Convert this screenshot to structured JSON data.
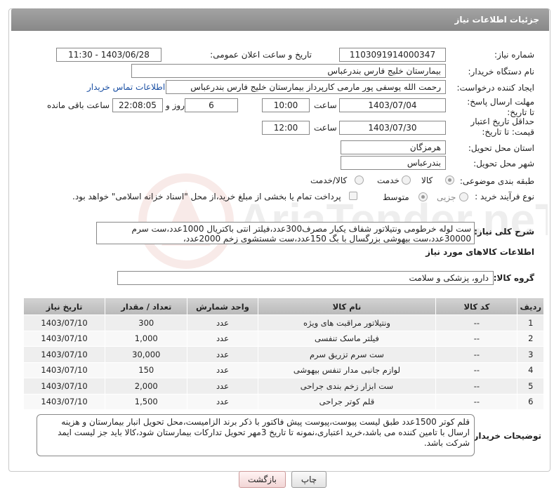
{
  "header": {
    "title": "جزئیات اطلاعات نیاز"
  },
  "form": {
    "need_number_label": "شماره نیاز:",
    "need_number": "1103091914000347",
    "announce_label": "تاریخ و ساعت اعلان عمومی:",
    "announce_value": "1403/06/28 - 11:30",
    "buyer_org_label": "نام دستگاه خریدار:",
    "buyer_org": "بیمارستان خلیج فارس بندرعباس",
    "creator_label": "ایجاد کننده درخواست:",
    "creator": "رحمت الله یوسفی پور مارمی کارپرداز بیمارستان خلیج فارس بندرعباس",
    "contact_link": "اطلاعات تماس خریدار",
    "deadline_label": "مهلت ارسال پاسخ: تا تاریخ:",
    "deadline_date": "1403/07/04",
    "time_label": "ساعت",
    "deadline_time": "10:00",
    "days_value": "6",
    "days_label": "روز و",
    "remaining_time": "22:08:05",
    "remaining_label": "ساعت باقی مانده",
    "validity_label": "حداقل تاریخ اعتبار قیمت: تا تاریخ:",
    "validity_date": "1403/07/30",
    "validity_time": "12:00",
    "province_label": "استان محل تحویل:",
    "province": "هرمزگان",
    "city_label": "شهر محل تحویل:",
    "city": "بندرعباس",
    "category_label": "طبقه بندی موضوعی:",
    "category_options": [
      "کالا",
      "خدمت",
      "کالا/خدمت"
    ],
    "category_selected": "کالا",
    "purchase_type_label": "نوع فرآیند خرید :",
    "purchase_options": [
      "جزیی",
      "متوسط"
    ],
    "purchase_selected": "متوسط",
    "payment_note": "پرداخت تمام یا بخشی از مبلغ خرید،از محل \"اسناد خزانه اسلامی\" خواهد بود."
  },
  "description": {
    "label": "شرح کلی نیاز:",
    "text": "ست لوله خرطومی ونتیلاتور شفاف یکبار مصرف300عدد،فیلتر انتی باکتریال 1000عدد،ست سرم 30000عدد،ست بیهوشی بزرگسال با بگ 150عدد،ست شستشوی زخم 2000عدد،"
  },
  "goods": {
    "section_title": "اطلاعات کالاهای مورد نیاز",
    "group_label": "گروه کالا:",
    "group_value": "دارو، پزشکی و سلامت",
    "columns": [
      "ردیف",
      "کد کالا",
      "نام کالا",
      "واحد شمارش",
      "تعداد / مقدار",
      "تاریخ نیاز"
    ],
    "rows": [
      [
        "1",
        "--",
        "ونتیلاتور مراقبت های ویژه",
        "عدد",
        "300",
        "1403/07/10"
      ],
      [
        "2",
        "--",
        "فیلتر ماسک تنفسی",
        "عدد",
        "1,000",
        "1403/07/10"
      ],
      [
        "3",
        "--",
        "ست سرم تزریق سرم",
        "عدد",
        "30,000",
        "1403/07/10"
      ],
      [
        "4",
        "--",
        "لوازم جانبی مدار تنفس بیهوشی",
        "عدد",
        "150",
        "1403/07/10"
      ],
      [
        "5",
        "--",
        "ست ابزار زخم بندی جراحی",
        "عدد",
        "2,000",
        "1403/07/10"
      ],
      [
        "6",
        "--",
        "قلم کوتر جراحی",
        "عدد",
        "1,500",
        "1403/07/10"
      ]
    ]
  },
  "buyer_notes": {
    "label": "توضیحات خریدار:",
    "text": "قلم کوتر 1500عدد طبق لیست پیوست،پیوست پیش فاکتور با ذکر برند الزامیست،محل تحویل انبار بیمارستان و هزینه ارسال با تامین کننده می باشد،خرید اعتباری،نمونه تا تاریخ 3مهر تحویل تدارکات بیمارستان شود،کالا باید جز لیست ایمد شرکت باشد."
  },
  "buttons": {
    "print": "چاپ",
    "back": "بازگشت"
  },
  "watermark": "AriaTender.neT"
}
